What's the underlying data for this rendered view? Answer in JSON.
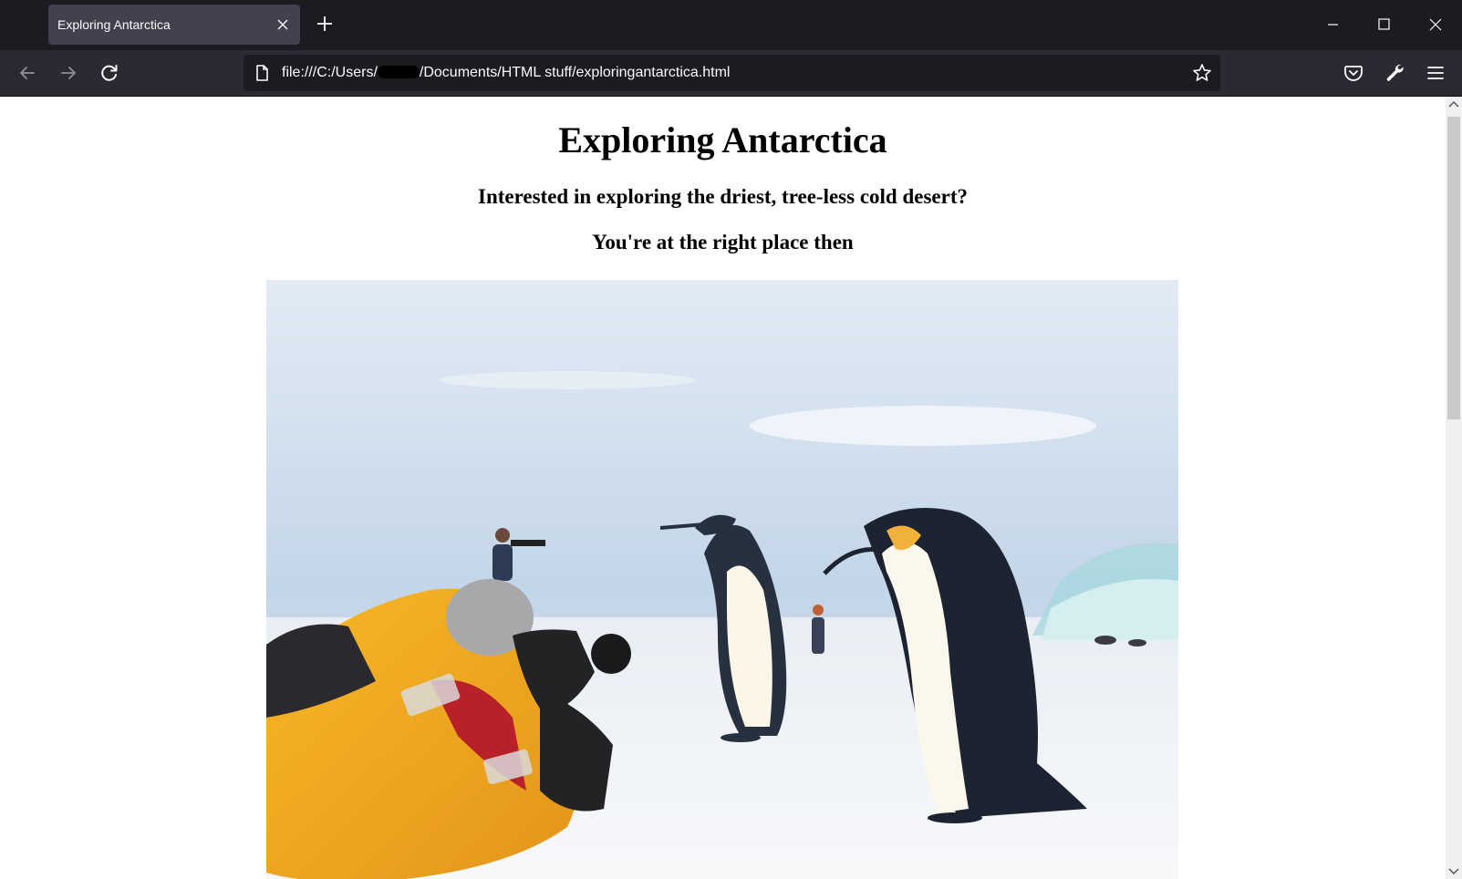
{
  "browser": {
    "tab": {
      "title": "Exploring Antarctica"
    },
    "url": {
      "prefix": "file:///C:/Users/",
      "suffix": "/Documents/HTML stuff/exploringantarctica.html"
    }
  },
  "page": {
    "heading": "Exploring Antarctica",
    "subheading": "Interested in exploring the driest, tree-less cold desert?",
    "tagline": "You're at the right place then"
  },
  "colors": {
    "chrome_dark": "#1c1b22",
    "toolbar": "#2b2a33",
    "active_tab": "#42414d",
    "page_bg": "#ffffff"
  },
  "icons": [
    "close-icon",
    "plus-icon",
    "minimize-icon",
    "maximize-icon",
    "window-close-icon",
    "back-arrow-icon",
    "forward-arrow-icon",
    "reload-icon",
    "page-icon",
    "star-icon",
    "pocket-icon",
    "wrench-icon",
    "hamburger-menu-icon"
  ]
}
